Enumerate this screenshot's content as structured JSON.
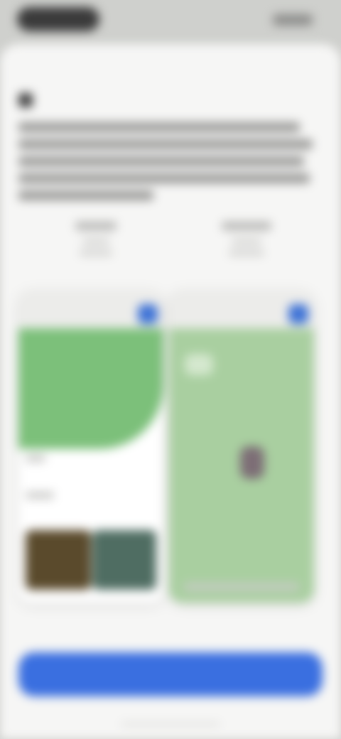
{
  "status_bar": {
    "time": "",
    "indicators": ""
  },
  "sheet": {
    "title": "",
    "description": ""
  },
  "columns": {
    "left_label": "",
    "right_label": ""
  },
  "preview_left": {
    "top_button_icon": "map-icon"
  },
  "preview_right": {
    "top_button_icon": "map-icon"
  },
  "cta": {
    "label": ""
  },
  "colors": {
    "accent": "#3a6fe0",
    "map_green": "#7cc07a",
    "map_field": "#a9cfa0"
  }
}
